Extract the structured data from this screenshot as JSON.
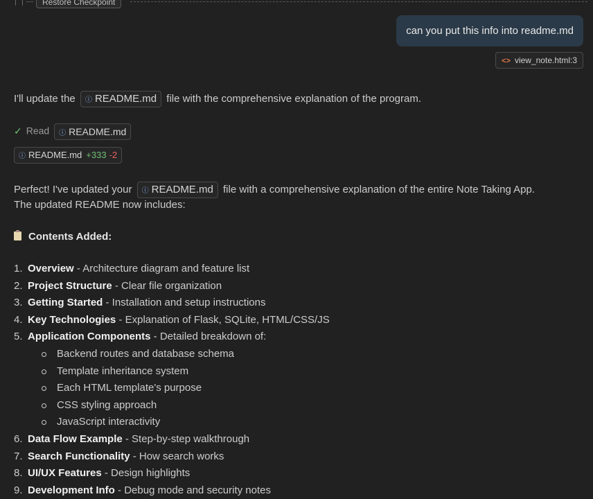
{
  "checkpoint": {
    "restore_label": "Restore Checkpoint"
  },
  "user_message": {
    "text": "can you put this info into readme.md",
    "context_file": "view_note.html:3"
  },
  "assistant": {
    "intro": {
      "before": "I'll update the",
      "file": "README.md",
      "after": "file with the comprehensive explanation of the program."
    },
    "read_action": {
      "label": "Read",
      "file": "README.md"
    },
    "edit": {
      "file": "README.md",
      "added": "+333",
      "removed": "-2"
    },
    "summary": {
      "before": "Perfect! I've updated your",
      "file": "README.md",
      "after": "file with a comprehensive explanation of the entire Note Taking App.",
      "line2": "The updated README now includes:"
    },
    "section_heading": "Contents Added:",
    "items": [
      {
        "num": "1.",
        "title": "Overview",
        "desc": " - Architecture diagram and feature list"
      },
      {
        "num": "2.",
        "title": "Project Structure",
        "desc": " - Clear file organization"
      },
      {
        "num": "3.",
        "title": "Getting Started",
        "desc": " - Installation and setup instructions"
      },
      {
        "num": "4.",
        "title": "Key Technologies",
        "desc": " - Explanation of Flask, SQLite, HTML/CSS/JS"
      },
      {
        "num": "5.",
        "title": "Application Components",
        "desc": " - Detailed breakdown of:",
        "sub": [
          "Backend routes and database schema",
          "Template inheritance system",
          "Each HTML template's purpose",
          "CSS styling approach",
          "JavaScript interactivity"
        ]
      },
      {
        "num": "6.",
        "title": "Data Flow Example",
        "desc": " - Step-by-step walkthrough"
      },
      {
        "num": "7.",
        "title": "Search Functionality",
        "desc": " - How search works"
      },
      {
        "num": "8.",
        "title": "UI/UX Features",
        "desc": " - Design highlights"
      },
      {
        "num": "9.",
        "title": "Development Info",
        "desc": " - Debug mode and security notes"
      }
    ]
  }
}
